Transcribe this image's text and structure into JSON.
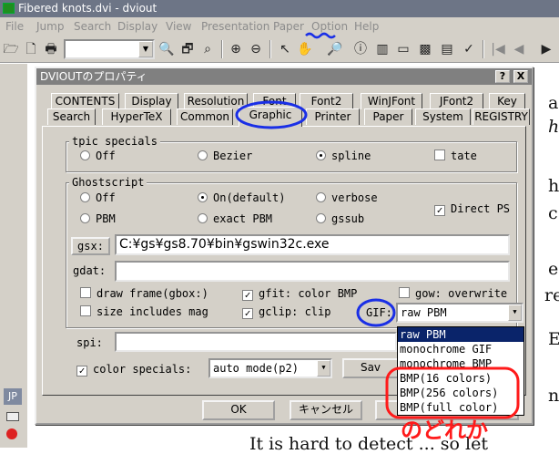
{
  "window": {
    "title": "Fibered knots.dvi - dviout",
    "menu": [
      "File",
      "Jump",
      "Search",
      "Display",
      "View",
      "Presentation",
      "Paper",
      "Option",
      "Help"
    ]
  },
  "toolbar": {
    "icons": [
      "open-folder-icon",
      "open-file-icon",
      "print-icon",
      "page-combo",
      "preview-icon",
      "search-icon",
      "search-next-icon",
      "zoom-in-icon",
      "zoom-out-icon",
      "pointer-icon",
      "hand-icon",
      "loupe-icon",
      "info-icon",
      "books-icon",
      "layout-icon",
      "pattern-icon",
      "scanner-icon",
      "checkmark-icon",
      "first-page-icon",
      "prev-page-icon",
      "next-page-icon"
    ],
    "glyphs": [
      "🗁",
      "🗋",
      "🖶",
      "🔍",
      "🗗",
      "⌕",
      "⊕",
      "⊖",
      "↖",
      "✋",
      "🔎",
      "ⓘ",
      "▥",
      "▭",
      "▩",
      "▤",
      "✓",
      "|◀",
      "◀",
      "▶"
    ]
  },
  "viewer": {
    "side_letters": [
      "a",
      "h",
      "h",
      "c",
      "e",
      "re",
      "E",
      "n"
    ],
    "bottom_text": "It is hard to detect ... so let"
  },
  "left_strip": {
    "badge": "JP"
  },
  "dialog": {
    "title": "DVIOUTのプロパティ",
    "help_btn": "?",
    "close_btn": "X",
    "tabs_row1": [
      "CONTENTS",
      "Display",
      "Resolution",
      "Font",
      "Font2",
      "WinJFont",
      "JFont2",
      "Key"
    ],
    "tabs_row2": [
      "Search",
      "HyperTeX",
      "Common",
      "Graphic",
      "Printer",
      "Paper",
      "System",
      "REGISTRY"
    ],
    "active_tab": "Graphic",
    "tpic": {
      "title": "tpic specials",
      "options": [
        "Off",
        "Bezier",
        "spline"
      ],
      "selected": "spline",
      "tate_label": "tate",
      "tate_checked": false
    },
    "ghostscript": {
      "title": "Ghostscript",
      "row1": [
        "Off",
        "On(default)",
        "verbose"
      ],
      "row2": [
        "PBM",
        "exact PBM",
        "gssub"
      ],
      "selected": "On(default)",
      "direct_ps_label": "Direct PS",
      "direct_ps_checked": true,
      "gsx_label": "gsx:",
      "gsx_value": "C:¥gs¥gs8.70¥bin¥gswin32c.exe",
      "gdat_label": "gdat:",
      "gdat_value": "",
      "draw_frame_label": "draw frame(gbox:)",
      "draw_frame_checked": false,
      "gfit_label": "gfit: color BMP",
      "gfit_checked": true,
      "gow_label": "gow: overwrite",
      "gow_checked": false,
      "size_mag_label": "size includes mag",
      "size_mag_checked": false,
      "gclip_label": "gclip: clip",
      "gclip_checked": true,
      "gif_label": "GIF:",
      "gif_value": "raw PBM",
      "gif_options": [
        "raw PBM",
        "monochrome GIF",
        "monochrome BMP",
        "BMP(16 colors)",
        "BMP(256 colors)",
        "BMP(full color)"
      ]
    },
    "spi_label": "spi:",
    "spi_value": "",
    "color_specials_label": "color specials:",
    "color_specials_checked": true,
    "color_mode_value": "auto mode(p2)",
    "save_button": "Sav",
    "ok_button": "OK",
    "cancel_button": "キャンセル"
  },
  "annotation": {
    "handwritten_note": "のどれか",
    "blue": "#1a2fe6",
    "red": "#ff1a1a"
  }
}
